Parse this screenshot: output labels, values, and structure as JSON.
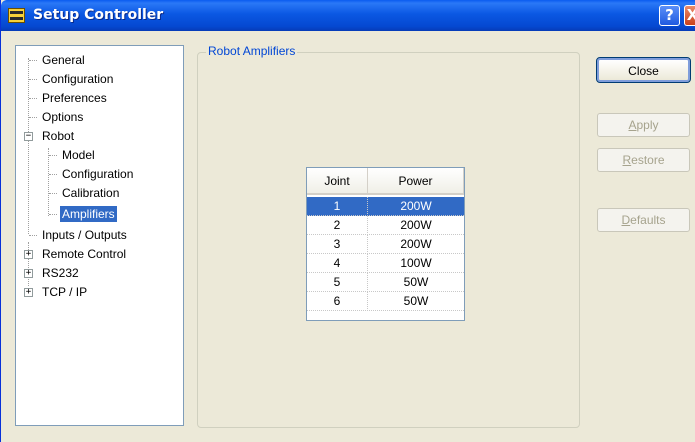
{
  "window": {
    "title": "Setup Controller"
  },
  "title_buttons": {
    "help": "?",
    "close": "X"
  },
  "tree": {
    "general": "General",
    "configuration": "Configuration",
    "preferences": "Preferences",
    "options": "Options",
    "robot": "Robot",
    "robot_model": "Model",
    "robot_configuration": "Configuration",
    "robot_calibration": "Calibration",
    "robot_amplifiers": "Amplifiers",
    "inputs_outputs": "Inputs / Outputs",
    "remote_control": "Remote Control",
    "rs232": "RS232",
    "tcp_ip": "TCP / IP",
    "expanded_sign": "−",
    "collapsed_sign": "+"
  },
  "group": {
    "label": "Robot Amplifiers"
  },
  "grid": {
    "headers": [
      "Joint",
      "Power"
    ],
    "rows": [
      [
        "1",
        "200W"
      ],
      [
        "2",
        "200W"
      ],
      [
        "3",
        "200W"
      ],
      [
        "4",
        "100W"
      ],
      [
        "5",
        "50W"
      ],
      [
        "6",
        "50W"
      ]
    ],
    "selected_row": 1
  },
  "buttons": {
    "close": "Close",
    "apply_first": "A",
    "apply_rest": "pply",
    "restore_first": "R",
    "restore_rest": "estore",
    "defaults_first": "D",
    "defaults_rest": "efaults"
  }
}
